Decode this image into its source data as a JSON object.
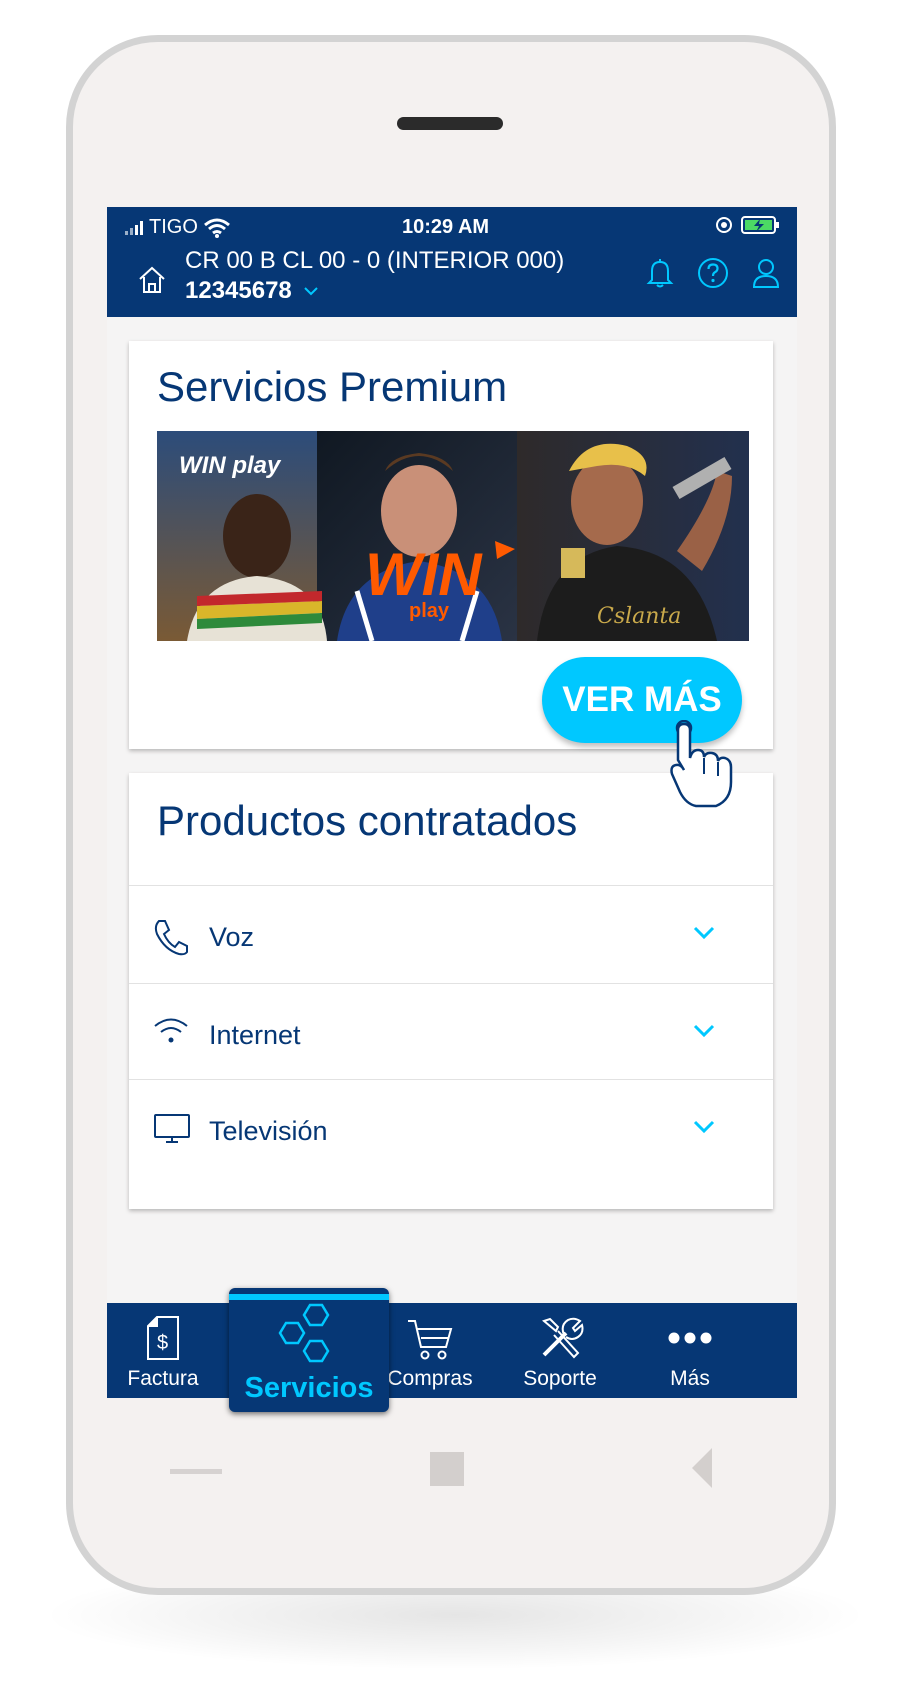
{
  "status_bar": {
    "carrier": "TIGO",
    "time": "10:29 AM"
  },
  "header": {
    "address": "CR 00 B CL 00 - 0 (INTERIOR 000)",
    "account": "12345678"
  },
  "premium": {
    "title": "Servicios Premium",
    "banner_logo_small": "WIN play",
    "banner_logo_main": "WIN",
    "banner_logo_sub": "play",
    "button_label": "VER MÁS"
  },
  "products": {
    "title": "Productos contratados",
    "items": [
      {
        "label": "Voz",
        "icon": "phone-icon"
      },
      {
        "label": "Internet",
        "icon": "wifi-icon"
      },
      {
        "label": "Televisión",
        "icon": "tv-icon"
      }
    ]
  },
  "nav": {
    "items": [
      {
        "label": "Factura",
        "icon": "invoice-icon"
      },
      {
        "label": "Servicios",
        "icon": "hexagons-icon",
        "active": true
      },
      {
        "label": "Compras",
        "icon": "cart-icon"
      },
      {
        "label": "Soporte",
        "icon": "tools-icon"
      },
      {
        "label": "Más",
        "icon": "more-dots-icon"
      }
    ]
  },
  "colors": {
    "brand_navy": "#063775",
    "accent_cyan": "#00c8ff",
    "win_orange": "#ff5a00"
  }
}
